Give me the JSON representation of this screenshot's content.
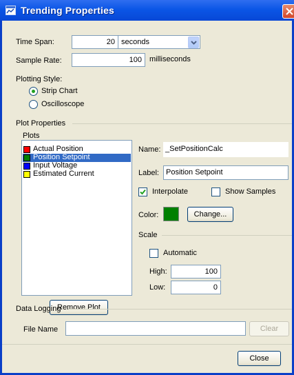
{
  "window": {
    "title": "Trending Properties"
  },
  "time_span": {
    "label": "Time Span:",
    "value": "20",
    "unit": "seconds"
  },
  "sample_rate": {
    "label": "Sample Rate:",
    "value": "100",
    "unit": "milliseconds"
  },
  "plotting_style": {
    "label": "Plotting Style:",
    "options": [
      {
        "label": "Strip Chart",
        "selected": true
      },
      {
        "label": "Oscilloscope",
        "selected": false
      }
    ]
  },
  "plot_properties": {
    "group_label": "Plot Properties",
    "plots_label": "Plots",
    "plots": [
      {
        "name": "Actual Position",
        "color": "#ff0000",
        "selected": false
      },
      {
        "name": "Position Setpoint",
        "color": "#008000",
        "selected": true
      },
      {
        "name": "Input Voltage",
        "color": "#0000ff",
        "selected": false
      },
      {
        "name": "Estimated Current",
        "color": "#ffff00",
        "selected": false
      }
    ],
    "remove_button": "Remove Plot",
    "name_label": "Name:",
    "name_value": "_SetPositionCalc",
    "label_label": "Label:",
    "label_value": "Position Setpoint",
    "interpolate_label": "Interpolate",
    "interpolate_checked": true,
    "show_samples_label": "Show Samples",
    "show_samples_checked": false,
    "color_label": "Color:",
    "color_value": "#008000",
    "change_button": "Change...",
    "scale": {
      "label": "Scale",
      "automatic_label": "Automatic",
      "automatic_checked": false,
      "high_label": "High:",
      "high_value": "100",
      "low_label": "Low:",
      "low_value": "0"
    }
  },
  "data_logging": {
    "group_label": "Data Logging",
    "file_name_label": "File Name",
    "file_name_value": "",
    "clear_button": "Clear"
  },
  "close_button": "Close"
}
